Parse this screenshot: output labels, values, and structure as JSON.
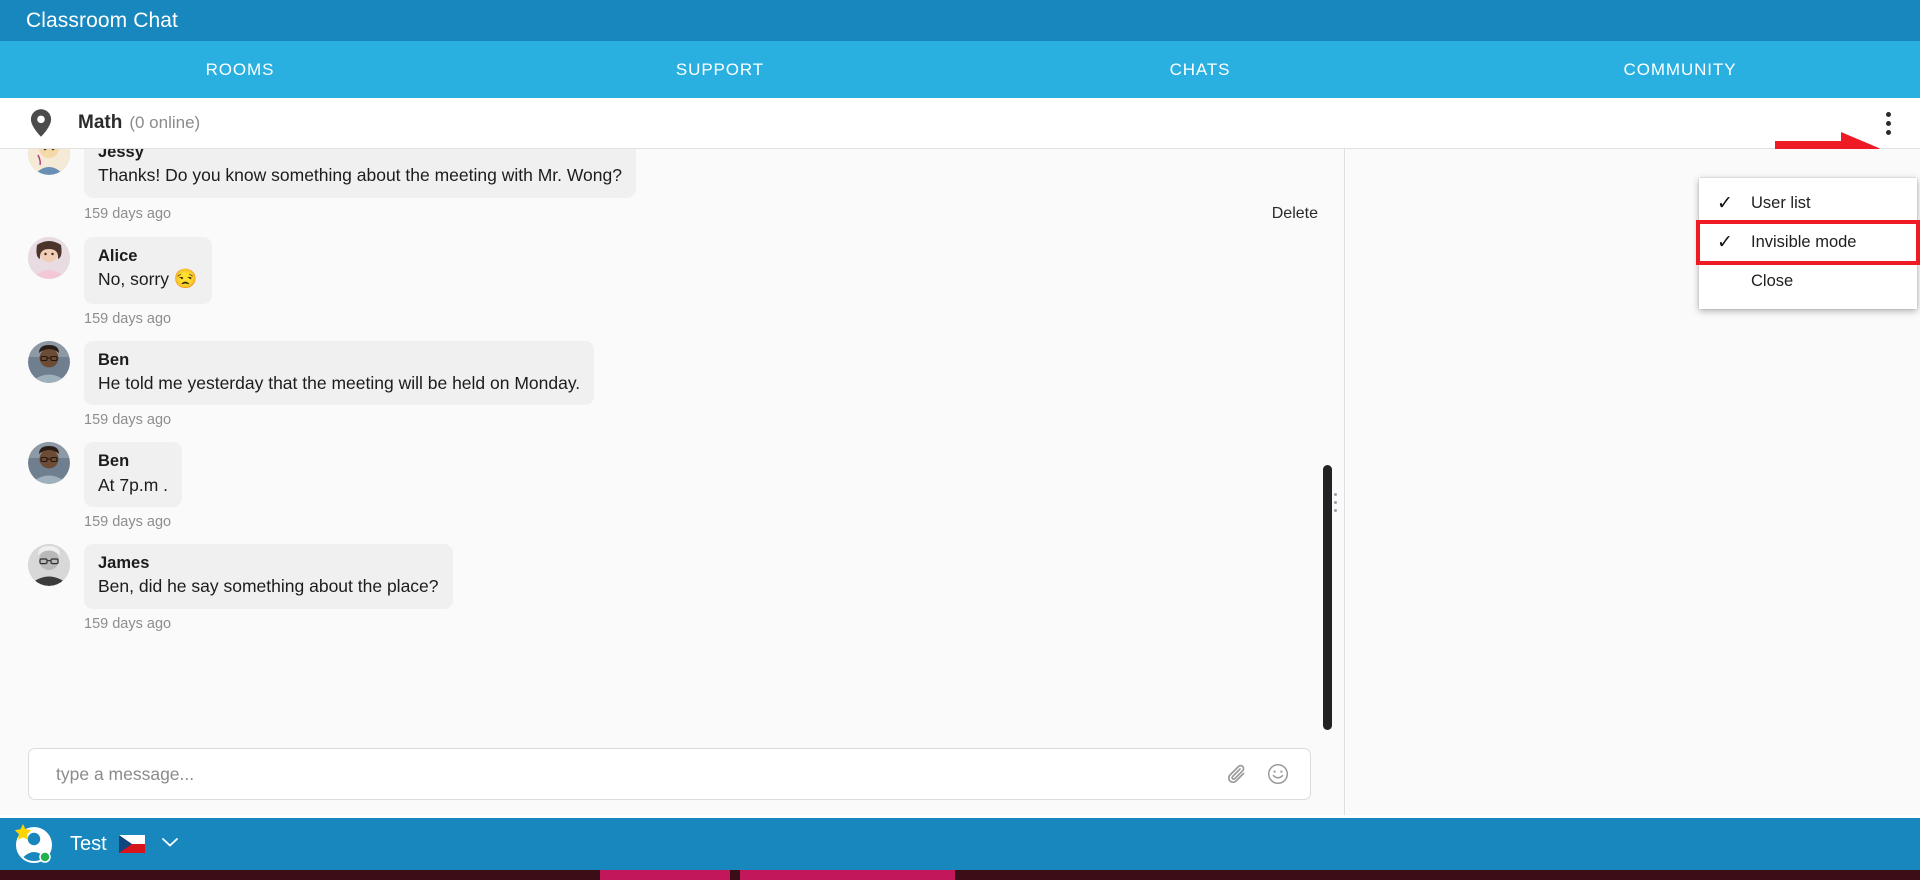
{
  "window": {
    "app_title": "Classroom Chat"
  },
  "nav": {
    "items": [
      {
        "label": "ROOMS",
        "name": "tab-rooms"
      },
      {
        "label": "SUPPORT",
        "name": "tab-support"
      },
      {
        "label": "CHATS",
        "name": "tab-chats"
      },
      {
        "label": "COMMUNITY",
        "name": "tab-community"
      }
    ]
  },
  "room": {
    "pin_icon": "location-pin-icon",
    "name": "Math",
    "online": "(0 online)",
    "menu_icon": "kebab-menu-icon"
  },
  "dropdown": {
    "items": [
      {
        "label": "User list",
        "checked": true,
        "highlighted": false
      },
      {
        "label": "Invisible mode",
        "checked": true,
        "highlighted": true
      },
      {
        "label": "Close",
        "checked": false,
        "highlighted": false
      }
    ],
    "check_glyph": "✓",
    "highlight_color": "#ee1b24"
  },
  "annotation": {
    "arrow_color": "#ee1b24",
    "arrow_name": "red-pointer-arrow"
  },
  "messages": [
    {
      "sender": "Jessy",
      "text": "Thanks! Do you know something about the meeting with Mr. Wong?",
      "timestamp": "159 days ago",
      "delete_label": "Delete",
      "avatar": "jessy-avatar"
    },
    {
      "sender": "Alice",
      "text": "No, sorry ",
      "emoji": "😒",
      "timestamp": "159 days ago",
      "delete_label": "",
      "avatar": "alice-avatar"
    },
    {
      "sender": "Ben",
      "text": "He told me yesterday that the meeting will be held on Monday.",
      "timestamp": "159 days ago",
      "delete_label": "",
      "avatar": "ben-avatar"
    },
    {
      "sender": "Ben",
      "text": "At 7p.m .",
      "timestamp": "159 days ago",
      "delete_label": "",
      "avatar": "ben-avatar"
    },
    {
      "sender": "James",
      "text": "Ben, did he say something about the place?",
      "timestamp": "159 days ago",
      "delete_label": "",
      "avatar": "james-avatar"
    }
  ],
  "composer": {
    "placeholder": "type a message...",
    "value": "",
    "attach_icon": "paperclip-icon",
    "emoji_icon": "smiley-face-icon"
  },
  "footer": {
    "user_name": "Test",
    "avatar": "user-avatar-with-star-badge",
    "status": "online",
    "flag": "czech-republic-flag",
    "caret_icon": "chevron-down-icon"
  },
  "colors": {
    "titlebar": "#1787bd",
    "navbar": "#29b0e0",
    "footer": "#1787bd",
    "bubble": "#f0f0f0",
    "pane": "#fafafa",
    "scrollbar": "#222225",
    "online_dot": "#23b14d"
  }
}
